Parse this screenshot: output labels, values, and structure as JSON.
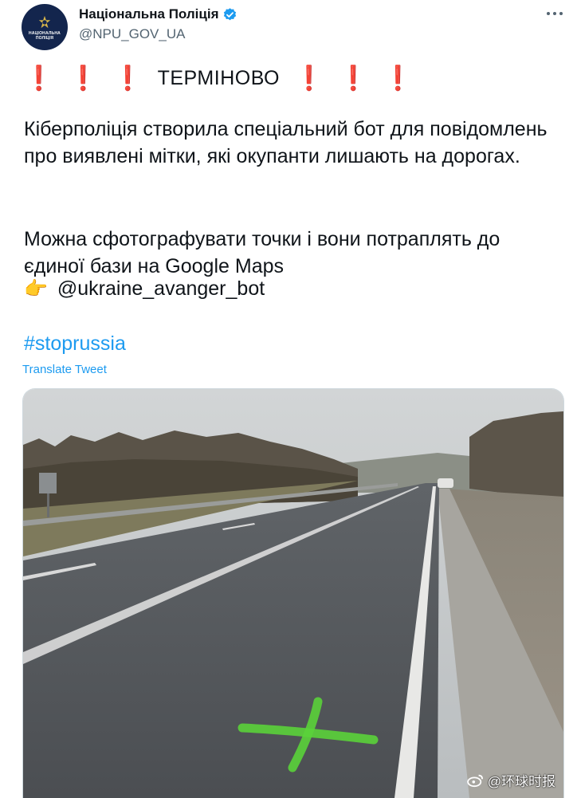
{
  "account": {
    "name": "Національна Поліція",
    "handle": "@NPU_GOV_UA",
    "avatar_text": "НАЦІОНАЛЬНА ПОЛІЦІЯ",
    "verified": true
  },
  "tweet": {
    "urgent": "ТЕРМІНОВО",
    "paragraph1": "Кіберполіція створила спеціальний бот для повідомлень про виявлені мітки, які окупанти лишають на дорогах.",
    "paragraph2": "Можна сфотографувати точки і вони потраплять до єдиної бази на Google Maps",
    "bot_handle": "@ukraine_avanger_bot",
    "hashtag": "#stoprussia",
    "translate": "Translate Tweet"
  },
  "media": {
    "description_icon": "road-photo",
    "watermark": "@环球时报"
  },
  "colors": {
    "link": "#1d9bf0",
    "exclamation": "#d51f2d",
    "verified": "#1d9bf0",
    "mark": "#5ad13a"
  }
}
